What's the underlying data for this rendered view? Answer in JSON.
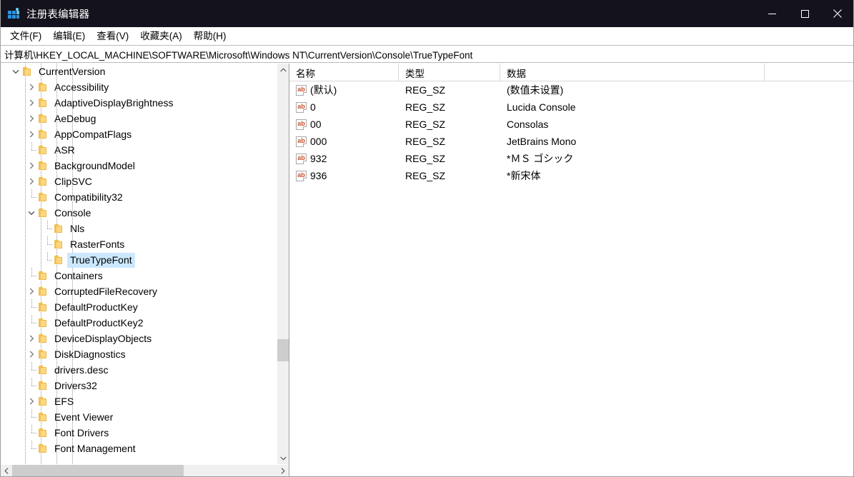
{
  "window": {
    "title": "注册表编辑器",
    "icon": "registry-editor-icon",
    "titlebar_color": "#14131d",
    "controls": {
      "minimize": "minimize-icon",
      "maximize": "maximize-icon",
      "close": "close-icon"
    }
  },
  "menubar": {
    "items": [
      {
        "label": "文件(F)"
      },
      {
        "label": "编辑(E)"
      },
      {
        "label": "查看(V)"
      },
      {
        "label": "收藏夹(A)"
      },
      {
        "label": "帮助(H)"
      }
    ]
  },
  "address": {
    "path": "计算机\\HKEY_LOCAL_MACHINE\\SOFTWARE\\Microsoft\\Windows NT\\CurrentVersion\\Console\\TrueTypeFont"
  },
  "tree": {
    "selected_color": "#cce8ff",
    "items": [
      {
        "label": "CurrentVersion",
        "depth": 4,
        "twisty": "expanded",
        "selected": false
      },
      {
        "label": "Accessibility",
        "depth": 5,
        "twisty": "collapsed",
        "selected": false
      },
      {
        "label": "AdaptiveDisplayBrightness",
        "depth": 5,
        "twisty": "collapsed",
        "selected": false
      },
      {
        "label": "AeDebug",
        "depth": 5,
        "twisty": "collapsed",
        "selected": false
      },
      {
        "label": "AppCompatFlags",
        "depth": 5,
        "twisty": "collapsed",
        "selected": false
      },
      {
        "label": "ASR",
        "depth": 5,
        "twisty": "leaf",
        "selected": false
      },
      {
        "label": "BackgroundModel",
        "depth": 5,
        "twisty": "collapsed",
        "selected": false
      },
      {
        "label": "ClipSVC",
        "depth": 5,
        "twisty": "collapsed",
        "selected": false
      },
      {
        "label": "Compatibility32",
        "depth": 5,
        "twisty": "leaf",
        "selected": false
      },
      {
        "label": "Console",
        "depth": 5,
        "twisty": "expanded",
        "selected": false
      },
      {
        "label": "Nls",
        "depth": 6,
        "twisty": "leaf",
        "selected": false
      },
      {
        "label": "RasterFonts",
        "depth": 6,
        "twisty": "leaf",
        "selected": false
      },
      {
        "label": "TrueTypeFont",
        "depth": 6,
        "twisty": "leaf",
        "selected": true
      },
      {
        "label": "Containers",
        "depth": 5,
        "twisty": "leaf",
        "selected": false
      },
      {
        "label": "CorruptedFileRecovery",
        "depth": 5,
        "twisty": "collapsed",
        "selected": false
      },
      {
        "label": "DefaultProductKey",
        "depth": 5,
        "twisty": "leaf",
        "selected": false
      },
      {
        "label": "DefaultProductKey2",
        "depth": 5,
        "twisty": "leaf",
        "selected": false
      },
      {
        "label": "DeviceDisplayObjects",
        "depth": 5,
        "twisty": "collapsed",
        "selected": false
      },
      {
        "label": "DiskDiagnostics",
        "depth": 5,
        "twisty": "collapsed",
        "selected": false
      },
      {
        "label": "drivers.desc",
        "depth": 5,
        "twisty": "leaf",
        "selected": false
      },
      {
        "label": "Drivers32",
        "depth": 5,
        "twisty": "leaf",
        "selected": false
      },
      {
        "label": "EFS",
        "depth": 5,
        "twisty": "collapsed",
        "selected": false
      },
      {
        "label": "Event Viewer",
        "depth": 5,
        "twisty": "leaf",
        "selected": false
      },
      {
        "label": "Font Drivers",
        "depth": 5,
        "twisty": "leaf",
        "selected": false
      },
      {
        "label": "Font Management",
        "depth": 5,
        "twisty": "leaf",
        "selected": false
      }
    ]
  },
  "list": {
    "columns": [
      {
        "label": "名称"
      },
      {
        "label": "类型"
      },
      {
        "label": "数据"
      }
    ],
    "rows": [
      {
        "icon": "string-value-icon",
        "name": "(默认)",
        "type": "REG_SZ",
        "data": "(数值未设置)"
      },
      {
        "icon": "string-value-icon",
        "name": "0",
        "type": "REG_SZ",
        "data": "Lucida Console"
      },
      {
        "icon": "string-value-icon",
        "name": "00",
        "type": "REG_SZ",
        "data": "Consolas"
      },
      {
        "icon": "string-value-icon",
        "name": "000",
        "type": "REG_SZ",
        "data": "JetBrains Mono"
      },
      {
        "icon": "string-value-icon",
        "name": "932",
        "type": "REG_SZ",
        "data": "*ＭＳ ゴシック"
      },
      {
        "icon": "string-value-icon",
        "name": "936",
        "type": "REG_SZ",
        "data": "*新宋体"
      }
    ]
  },
  "scrollbars": {
    "vertical": {
      "up": "chevron-up-icon",
      "down": "chevron-down-icon"
    },
    "horizontal": {
      "left": "chevron-left-icon",
      "right": "chevron-right-icon"
    }
  }
}
